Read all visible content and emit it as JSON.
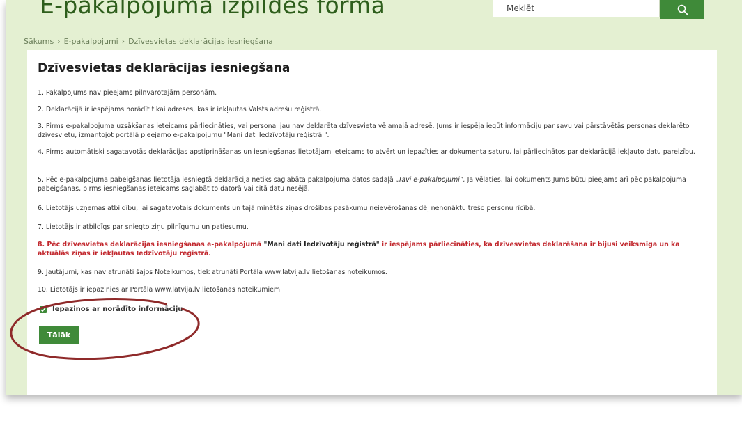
{
  "header": {
    "title": "E-pakalpojuma izpildes forma",
    "search_placeholder": "Meklēt",
    "search_icon": "search-icon"
  },
  "breadcrumb": [
    "Sākums",
    "E-pakalpojumi",
    "Dzīvesvietas deklarācijas iesniegšana"
  ],
  "main": {
    "title": "Dzīvesvietas deklarācijas iesniegšana",
    "items": [
      "1. Pakalpojums nav pieejams pilnvarotajām personām.",
      "2. Deklarācijā ir iespējams norādīt tikai adreses, kas ir iekļautas Valsts adrešu reģistrā.",
      "3. Pirms e-pakalpojuma uzsākšanas ieteicams pārliecināties, vai personai jau nav deklarēta dzīvesvieta vēlamajā adresē. Jums ir iespēja iegūt informāciju par savu vai pārstāvētās personas deklarēto dzīvesvietu, izmantojot portālā pieejamo e-pakalpojumu \"Mani dati Iedzīvotāju reģistrā \".",
      "4. Pirms automātiski sagatavotās deklarācijas apstiprināšanas un iesniegšanas lietotājam ieteicams to atvērt un iepazīties ar dokumenta saturu, lai pārliecinātos par deklarācijā iekļauto datu pareizību.",
      {
        "before": "5. Pēc e-pakalpojuma pabeigšanas lietotāja iesniegtā deklarācija netiks saglabāta pakalpojuma datos sadaļā ",
        "emphasis": "„Tavi e-pakalpojumi”.",
        "after": " Ja vēlaties, lai dokuments Jums būtu pieejams arī pēc pakalpojuma pabeigšanas, pirms iesniegšanas ieteicams saglabāt to datorā vai citā datu nesējā."
      },
      "6. Lietotājs uzņemas atbildību, lai sagatavotais dokuments un tajā minētās ziņas drošības pasākumu neievērošanas dēļ nenonāktu trešo personu rīcībā.",
      "7. Lietotājs ir atbildīgs par sniegto ziņu pilnīgumu un patiesumu.",
      {
        "before": "8. Pēc dzīvesvietas deklarācijas iesniegšanas e-pakalpojumā ",
        "emphasis": "\"Mani dati Iedzīvotāju reģistrā\"",
        "after": " ir iespējams pārliecināties, ka dzīvesvietas deklarēšana ir bijusi veiksmīga un ka aktuālās ziņas ir iekļautas Iedzīvotāju reģistrā."
      },
      "9. Jautājumi, kas nav atrunāti šajos Noteikumos, tiek atrunāti Portāla www.latvija.lv lietošanas noteikumos.",
      "10. Lietotājs ir iepazinies ar Portāla www.latvija.lv lietošanas noteikumiem."
    ],
    "consent_label": "Iepazinos ar norādīto informāciju",
    "consent_checked": true,
    "next_label": "Tālāk"
  },
  "colors": {
    "page_bg": "#e4f0d2",
    "brand_green": "#3f8a39",
    "title_green": "#2e5e1c",
    "alert_red": "#c1272d",
    "annotation_ring": "#8f2a2a"
  }
}
